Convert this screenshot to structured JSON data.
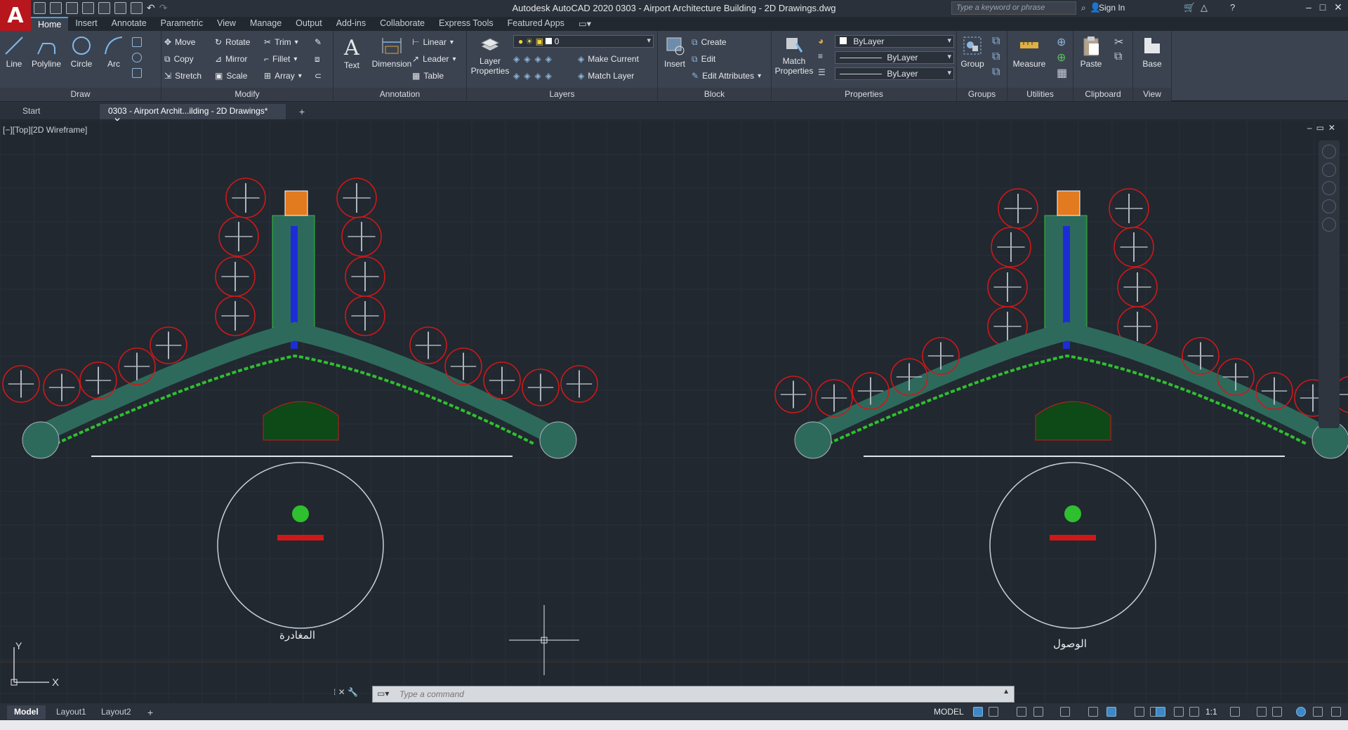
{
  "app": {
    "title": "Autodesk AutoCAD 2020    0303 - Airport Architecture Building - 2D Drawings.dwg",
    "logo": "A"
  },
  "search": {
    "placeholder": "Type a keyword or phrase"
  },
  "account": {
    "sign_in": "Sign In"
  },
  "ribbon_tabs": [
    "Home",
    "Insert",
    "Annotate",
    "Parametric",
    "View",
    "Manage",
    "Output",
    "Add-ins",
    "Collaborate",
    "Express Tools",
    "Featured Apps"
  ],
  "draw": {
    "title": "Draw",
    "line": "Line",
    "polyline": "Polyline",
    "circle": "Circle",
    "arc": "Arc"
  },
  "modify": {
    "title": "Modify",
    "move": "Move",
    "rotate": "Rotate",
    "trim": "Trim",
    "copy": "Copy",
    "mirror": "Mirror",
    "fillet": "Fillet",
    "stretch": "Stretch",
    "scale": "Scale",
    "array": "Array"
  },
  "annotation": {
    "title": "Annotation",
    "text": "Text",
    "dimension": "Dimension",
    "linear": "Linear",
    "leader": "Leader",
    "table": "Table"
  },
  "layers": {
    "title": "Layers",
    "layer_properties": "Layer Properties",
    "current_layer": "0",
    "make_current": "Make Current",
    "match_layer": "Match Layer"
  },
  "block": {
    "title": "Block",
    "insert": "Insert",
    "create": "Create",
    "edit": "Edit",
    "edit_attributes": "Edit Attributes"
  },
  "properties": {
    "title": "Properties",
    "match_properties": "Match Properties",
    "color": "ByLayer",
    "linetype": "ByLayer",
    "lineweight": "ByLayer"
  },
  "groups": {
    "title": "Groups",
    "group": "Group"
  },
  "utilities": {
    "title": "Utilities",
    "measure": "Measure"
  },
  "clipboard": {
    "title": "Clipboard",
    "paste": "Paste"
  },
  "view_panel": {
    "title": "View",
    "base": "Base"
  },
  "file_tabs": {
    "start": "Start",
    "drawing": "0303 - Airport Archit...ilding - 2D Drawings*"
  },
  "viewport": {
    "label": "[−][Top][2D Wireframe]",
    "ucs_y": "Y",
    "ucs_x": "X"
  },
  "plans": {
    "departures_label": "المغادرة",
    "arrivals_label": "الوصول"
  },
  "command": {
    "placeholder": "Type a command"
  },
  "layout_tabs": [
    "Model",
    "Layout1",
    "Layout2"
  ],
  "status": {
    "mode": "MODEL",
    "scale": "1:1"
  },
  "colors": {
    "plan_red": "#d01818",
    "plan_green": "#2ec02e",
    "plan_teal": "#2e6a5c",
    "accent_blue": "#3f88c5"
  }
}
